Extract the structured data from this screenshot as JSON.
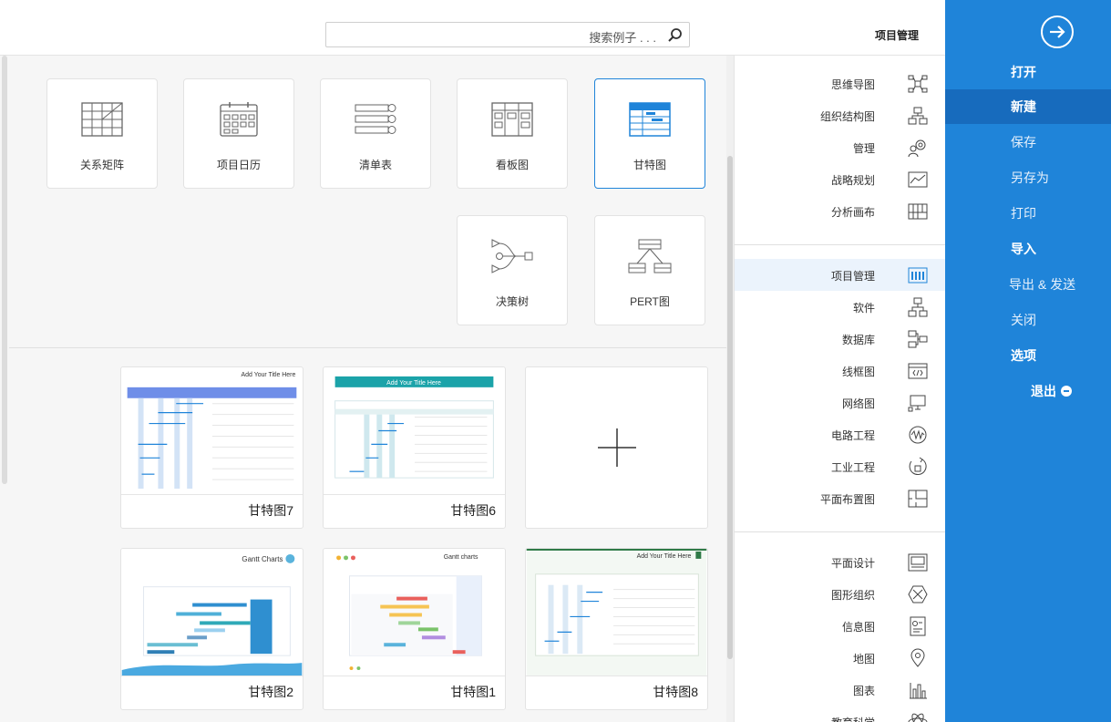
{
  "header": {
    "title": "项目管理",
    "search_placeholder": "搜索例子 . . ."
  },
  "file_menu": {
    "items": [
      {
        "label": "打开",
        "style": "bold"
      },
      {
        "label": "新建",
        "style": "active"
      },
      {
        "label": "保存",
        "style": "normal"
      },
      {
        "label": "另存为",
        "style": "normal"
      },
      {
        "label": "打印",
        "style": "normal"
      },
      {
        "label": "导入",
        "style": "bold"
      },
      {
        "label": "导出 & 发送",
        "style": "normal"
      },
      {
        "label": "关闭",
        "style": "normal"
      },
      {
        "label": "选项",
        "style": "bold"
      },
      {
        "label": "退出",
        "style": "bold"
      }
    ],
    "accent": "#1f84d9"
  },
  "categories": {
    "group1": [
      {
        "label": "思维导图",
        "icon": "mindmap-icon"
      },
      {
        "label": "组织结构图",
        "icon": "org-chart-icon"
      },
      {
        "label": "管理",
        "icon": "gear-people-icon"
      },
      {
        "label": "战略规划",
        "icon": "strategy-icon"
      },
      {
        "label": "分析画布",
        "icon": "canvas-icon"
      }
    ],
    "group2": [
      {
        "label": "项目管理",
        "icon": "project-icon",
        "selected": true
      },
      {
        "label": "软件",
        "icon": "software-icon"
      },
      {
        "label": "数据库",
        "icon": "database-icon"
      },
      {
        "label": "线框图",
        "icon": "wireframe-icon"
      },
      {
        "label": "网络图",
        "icon": "network-icon"
      },
      {
        "label": "电路工程",
        "icon": "circuit-icon"
      },
      {
        "label": "工业工程",
        "icon": "industrial-icon"
      },
      {
        "label": "平面布置图",
        "icon": "floorplan-icon"
      }
    ],
    "group3": [
      {
        "label": "平面设计",
        "icon": "graphic-design-icon"
      },
      {
        "label": "图形组织",
        "icon": "graphic-organizer-icon"
      },
      {
        "label": "信息图",
        "icon": "infographic-icon"
      },
      {
        "label": "地图",
        "icon": "map-pin-icon"
      },
      {
        "label": "图表",
        "icon": "bar-chart-icon"
      },
      {
        "label": "教育科学",
        "icon": "atom-icon"
      }
    ]
  },
  "templates": [
    {
      "label": "甘特图",
      "selected": true
    },
    {
      "label": "看板图"
    },
    {
      "label": "清单表"
    },
    {
      "label": "项目日历"
    },
    {
      "label": "关系矩阵"
    },
    {
      "label": "PERT图"
    },
    {
      "label": "决策树"
    }
  ],
  "examples": [
    {
      "label": ""
    },
    {
      "label": "甘特图6",
      "heading": "Add Your Title Here"
    },
    {
      "label": "甘特图7",
      "heading": "Add Your Title Here"
    },
    {
      "label": "甘特图8",
      "heading": "Add Your Title Here"
    },
    {
      "label": "甘特图1",
      "heading": "Gantt charts"
    },
    {
      "label": "甘特图2",
      "heading": "Gantt Charts"
    }
  ]
}
